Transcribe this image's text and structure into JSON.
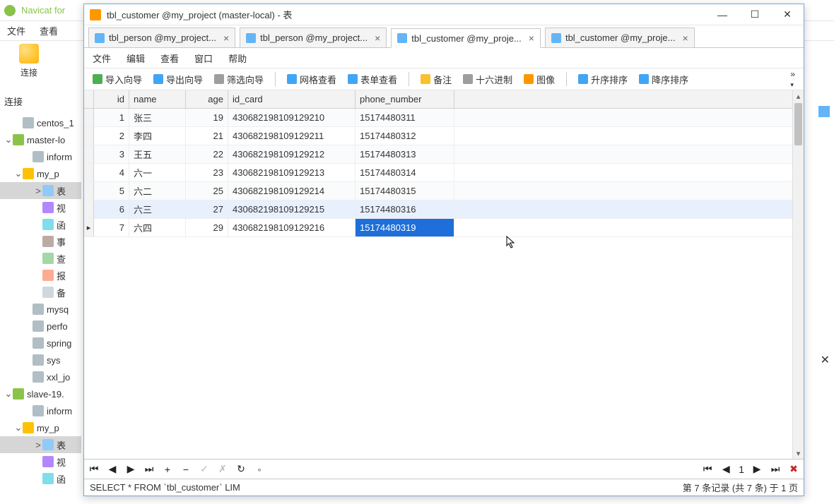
{
  "outer": {
    "title": "Navicat for",
    "menu": [
      "文件",
      "查看"
    ],
    "connect_label": "连接",
    "connections_label": "连接"
  },
  "tree": [
    {
      "indent": 1,
      "ico": "db",
      "label": "centos_1"
    },
    {
      "chev": "⌄",
      "indent": 0,
      "ico": "srv",
      "label": "master-lo"
    },
    {
      "indent": 2,
      "ico": "db",
      "label": "inform"
    },
    {
      "chev": "⌄",
      "indent": 1,
      "ico": "schema",
      "label": "my_p"
    },
    {
      "chev": ">",
      "indent": 3,
      "ico": "tbl",
      "label": "表",
      "sel": true
    },
    {
      "indent": 3,
      "ico": "view",
      "label": "视"
    },
    {
      "indent": 3,
      "ico": "fn",
      "label": "函"
    },
    {
      "indent": 3,
      "ico": "evt",
      "label": "事"
    },
    {
      "indent": 3,
      "ico": "qry",
      "label": "查"
    },
    {
      "indent": 3,
      "ico": "rpt",
      "label": "报"
    },
    {
      "indent": 3,
      "ico": "bak",
      "label": "备"
    },
    {
      "indent": 2,
      "ico": "db",
      "label": "mysq"
    },
    {
      "indent": 2,
      "ico": "db",
      "label": "perfo"
    },
    {
      "indent": 2,
      "ico": "db",
      "label": "spring"
    },
    {
      "indent": 2,
      "ico": "db",
      "label": "sys"
    },
    {
      "indent": 2,
      "ico": "db",
      "label": "xxl_jo"
    },
    {
      "chev": "⌄",
      "indent": 0,
      "ico": "srv",
      "label": "slave-19."
    },
    {
      "indent": 2,
      "ico": "db",
      "label": "inform"
    },
    {
      "chev": "⌄",
      "indent": 1,
      "ico": "schema",
      "label": "my_p"
    },
    {
      "chev": ">",
      "indent": 3,
      "ico": "tbl",
      "label": "表",
      "sel": true
    },
    {
      "indent": 3,
      "ico": "view",
      "label": "视"
    },
    {
      "indent": 3,
      "ico": "fn",
      "label": "函"
    }
  ],
  "window": {
    "title": "tbl_customer @my_project (master-local) - 表",
    "win_ctrl": {
      "min": "—",
      "max": "☐",
      "close": "✕"
    },
    "tabs": [
      {
        "label": "tbl_person @my_project...",
        "active": false
      },
      {
        "label": "tbl_person @my_project...",
        "active": false
      },
      {
        "label": "tbl_customer @my_proje...",
        "active": true
      },
      {
        "label": "tbl_customer @my_proje...",
        "active": false
      }
    ],
    "menu": [
      "文件",
      "编辑",
      "查看",
      "窗口",
      "帮助"
    ],
    "toolbar": {
      "import": "导入向导",
      "export": "导出向导",
      "filter": "筛选向导",
      "gridview": "网格查看",
      "formview": "表单查看",
      "note": "备注",
      "hex": "十六进制",
      "image": "图像",
      "asc": "升序排序",
      "desc": "降序排序",
      "more": "»"
    },
    "columns": [
      "id",
      "name",
      "age",
      "id_card",
      "phone_number"
    ],
    "rows": [
      {
        "id": "1",
        "name": "张三",
        "age": "19",
        "id_card": "430682198109129210",
        "phone": "15174480311"
      },
      {
        "id": "2",
        "name": "李四",
        "age": "21",
        "id_card": "430682198109129211",
        "phone": "15174480312"
      },
      {
        "id": "3",
        "name": "王五",
        "age": "22",
        "id_card": "430682198109129212",
        "phone": "15174480313"
      },
      {
        "id": "4",
        "name": "六一",
        "age": "23",
        "id_card": "430682198109129213",
        "phone": "15174480314"
      },
      {
        "id": "5",
        "name": "六二",
        "age": "25",
        "id_card": "430682198109129214",
        "phone": "15174480315"
      },
      {
        "id": "6",
        "name": "六三",
        "age": "27",
        "id_card": "430682198109129215",
        "phone": "15174480316"
      },
      {
        "id": "7",
        "name": "六四",
        "age": "29",
        "id_card": "430682198109129216",
        "phone": "15174480319"
      }
    ],
    "current_row_index": 6,
    "selected_cell": {
      "row": 6,
      "col": "phone"
    },
    "nav": {
      "first": "⏮",
      "prev": "◀",
      "next": "▶",
      "last": "⏭",
      "add": "+",
      "del": "−",
      "ok": "✓",
      "cancel": "✗",
      "refresh": "↻",
      "stop": "◦",
      "page": "1",
      "right_first": "⏮",
      "right_prev": "◀",
      "right_next": "▶",
      "right_last": "⏭",
      "right_tool": "✖"
    },
    "status": {
      "sql": "SELECT * FROM `tbl_customer` LIM",
      "info": "第 7 条记录 (共 7 条) 于 1 页"
    }
  }
}
